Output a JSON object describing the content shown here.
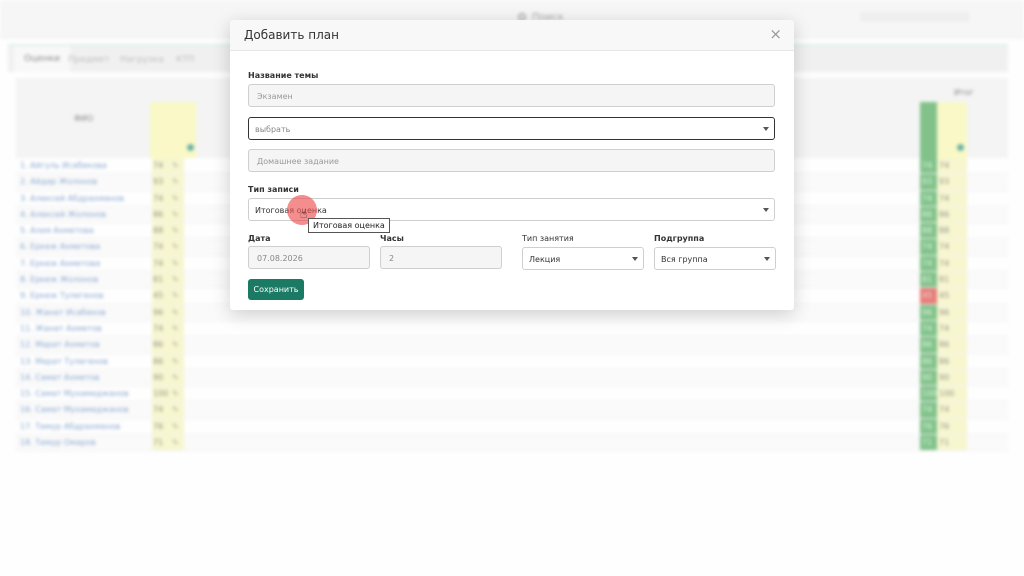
{
  "background": {
    "search_label": "Поиск",
    "tabs": [
      "Оценки",
      "Предмет",
      "Нагрузка",
      "КТП"
    ],
    "table": {
      "fio_header": "ФИО",
      "itog_header": "Итог",
      "rows": [
        {
          "name": "1. Айгуль Исабекова",
          "score": "74",
          "itog": "74",
          "red": false
        },
        {
          "name": "2. Айдар Жолонов",
          "score": "93",
          "itog": "93",
          "red": false
        },
        {
          "name": "3. Алексей Абдрахманов",
          "score": "74",
          "itog": "74",
          "red": false
        },
        {
          "name": "4. Алексей Жолонов",
          "score": "86",
          "itog": "86",
          "red": false
        },
        {
          "name": "5. Алия Ахметова",
          "score": "88",
          "itog": "88",
          "red": false
        },
        {
          "name": "6. Еркеж Ахметова",
          "score": "74",
          "itog": "74",
          "red": false
        },
        {
          "name": "7. Еркеж Ахметова",
          "score": "74",
          "itog": "74",
          "red": false
        },
        {
          "name": "8. Еркеж Жолонов",
          "score": "81",
          "itog": "81",
          "red": false
        },
        {
          "name": "9. Еркеж Тулегенов",
          "score": "45",
          "itog": "45",
          "red": true
        },
        {
          "name": "10. Жанат Исабеков",
          "score": "96",
          "itog": "96",
          "red": false
        },
        {
          "name": "11. Жанат Ахметов",
          "score": "74",
          "itog": "74",
          "red": false
        },
        {
          "name": "12. Марат Ахметов",
          "score": "86",
          "itog": "86",
          "red": false
        },
        {
          "name": "13. Марат Тулегенов",
          "score": "86",
          "itog": "86",
          "red": false
        },
        {
          "name": "14. Самат Ахметов",
          "score": "90",
          "itog": "90",
          "red": false
        },
        {
          "name": "15. Самат Мухамеджанов",
          "score": "100",
          "itog": "100",
          "red": false
        },
        {
          "name": "16. Самат Мухамеджанов",
          "score": "74",
          "itog": "74",
          "red": false
        },
        {
          "name": "17. Тимур Абдрахманов",
          "score": "76",
          "itog": "76",
          "red": false
        },
        {
          "name": "18. Тимур Омаров",
          "score": "71",
          "itog": "71",
          "red": false
        }
      ]
    }
  },
  "modal": {
    "title": "Добавить план",
    "close_icon": "close-icon",
    "topic_label": "Название темы",
    "topic_placeholder": "Экзамен",
    "select_placeholder": "выбрать",
    "homework_placeholder": "Домашнее задание",
    "record_type_label": "Тип записи",
    "record_type_value": "Итоговая оценка",
    "date_label": "Дата",
    "date_value": "07.08.2026",
    "hours_label": "Часы",
    "hours_value": "2",
    "lesson_type_label": "Тип занятия",
    "lesson_type_value": "Лекция",
    "subgroup_label": "Подгруппа",
    "subgroup_value": "Вся группа",
    "save_label": "Сохранить"
  },
  "tooltip": {
    "text": "Итоговая оценка"
  },
  "colors": {
    "accent": "#1b7a63",
    "yellow_col": "#f6f5a8",
    "green_col": "#3fa24c",
    "red_cell": "#d63b31"
  }
}
